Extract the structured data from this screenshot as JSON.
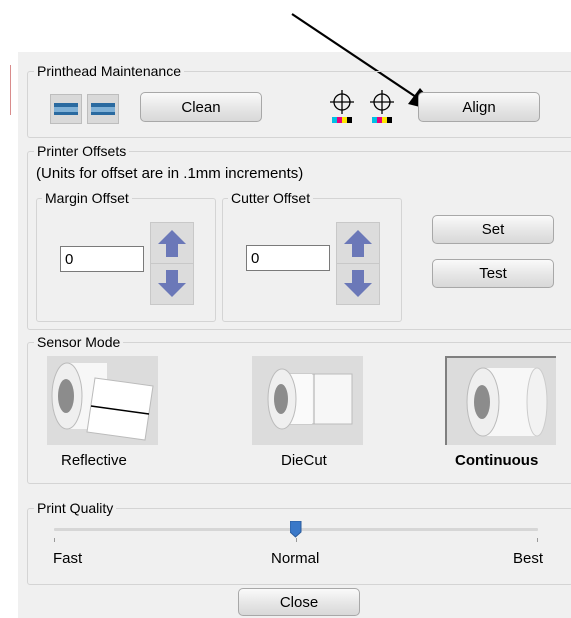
{
  "printhead": {
    "title": "Printhead Maintenance",
    "clean_label": "Clean",
    "align_label": "Align"
  },
  "offsets": {
    "title": "Printer Offsets",
    "note": "(Units for offset are in .1mm increments)",
    "margin": {
      "title": "Margin Offset",
      "value": "0"
    },
    "cutter": {
      "title": "Cutter Offset",
      "value": "0"
    },
    "set_label": "Set",
    "test_label": "Test"
  },
  "sensor": {
    "title": "Sensor Mode",
    "modes": [
      {
        "label": "Reflective",
        "selected": false
      },
      {
        "label": "DieCut",
        "selected": false
      },
      {
        "label": "Continuous",
        "selected": true
      }
    ]
  },
  "quality": {
    "title": "Print Quality",
    "labels": [
      "Fast",
      "Normal",
      "Best"
    ],
    "level": 0.5
  },
  "close_label": "Close",
  "colors": {
    "arrow_blue": "#6b78b8",
    "slider_blue": "#3a78c8",
    "cyan": "#00bfe6",
    "magenta": "#e6007e",
    "yellow": "#ffe600",
    "black": "#000000"
  }
}
